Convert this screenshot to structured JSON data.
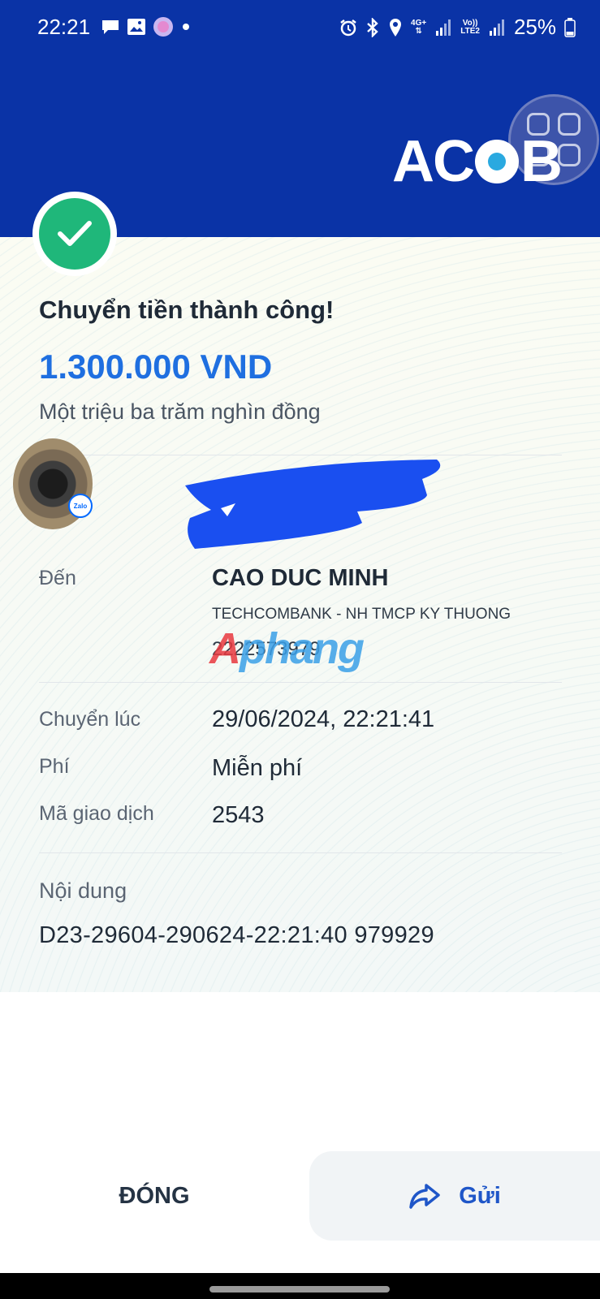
{
  "status_bar": {
    "time": "22:21",
    "left_icons": [
      "chat-icon",
      "gallery-icon",
      "messenger-icon",
      "dot-icon"
    ],
    "right_icons": [
      "alarm-icon",
      "bluetooth-icon",
      "location-icon",
      "4g-data-icon",
      "signal-icon",
      "volte-lte2-icon",
      "signal-icon"
    ],
    "network_label_1": "4G+",
    "network_label_2": "Vo))\nLTE2",
    "battery": "25%"
  },
  "header": {
    "logo_text": "ACB",
    "bg_color": "#0a33a6"
  },
  "receipt": {
    "title": "Chuyển tiền thành công!",
    "amount": "1.300.000 VND",
    "amount_words": "Một triệu ba trăm nghìn đồng",
    "avatar_badge": "Zalo",
    "recipient": {
      "label": "Đến",
      "name": "CAO DUC MINH",
      "bank": "TECHCOMBANK - NH TMCP KY THUONG",
      "account": "2222573979"
    },
    "watermark": {
      "red": "A",
      "blue": "phang"
    },
    "details": [
      {
        "label": "Chuyển lúc",
        "value": "29/06/2024, 22:21:41"
      },
      {
        "label": "Phí",
        "value": "Miễn phí"
      },
      {
        "label": "Mã giao dịch",
        "value": "2543"
      }
    ],
    "memo": {
      "label": "Nội dung",
      "value": "D23-29604-290624-22:21:40 979929"
    }
  },
  "footer": {
    "close_label": "ĐÓNG",
    "send_label": "Gửi",
    "send_icon": "share-arrow-icon"
  },
  "colors": {
    "brand": "#0a33a6",
    "amount": "#1f6fe0",
    "success": "#1fb77a",
    "redaction": "#1a4ff0"
  }
}
